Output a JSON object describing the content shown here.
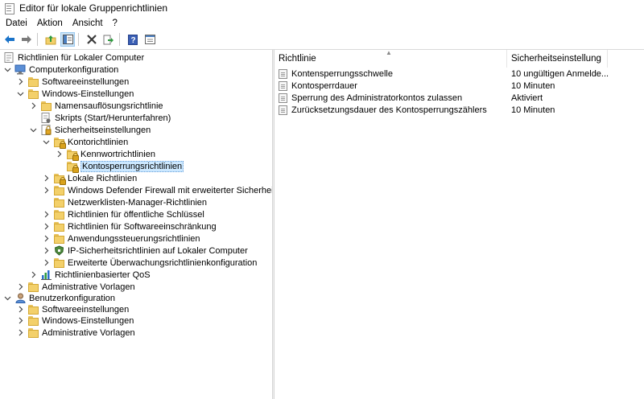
{
  "window": {
    "title": "Editor für lokale Gruppenrichtlinien"
  },
  "menu": {
    "items": [
      "Datei",
      "Aktion",
      "Ansicht",
      "?"
    ]
  },
  "colors": {
    "selection": "#cce8ff",
    "folder": "#f3d06a",
    "back_arrow": "#1a73c9",
    "forward_arrow": "#7a7a7a"
  },
  "toolbar": {
    "buttons": [
      "back-icon",
      "forward-icon",
      "up-folder-icon",
      "show-hide-tree-icon",
      "delete-icon",
      "export-list-icon",
      "help-icon",
      "properties-icon"
    ]
  },
  "tree": {
    "root": "Richtlinien für Lokaler Computer",
    "computer": "Computerkonfiguration",
    "c_software": "Softwareeinstellungen",
    "c_windows": "Windows-Einstellungen",
    "c_names": "Namensauflösungsrichtlinie",
    "c_scripts": "Skripts (Start/Herunterfahren)",
    "c_security": "Sicherheitseinstellungen",
    "c_account": "Kontorichtlinien",
    "c_password": "Kennwortrichtlinien",
    "c_lockout": "Kontosperrungsrichtlinien",
    "c_local": "Lokale Richtlinien",
    "c_firewall": "Windows Defender Firewall mit erweiterter Sicherheit",
    "c_netlist": "Netzwerklisten-Manager-Richtlinien",
    "c_pubkey": "Richtlinien für öffentliche Schlüssel",
    "c_srp": "Richtlinien für Softwareeinschränkung",
    "c_applocker": "Anwendungssteuerungsrichtlinien",
    "c_ipsec": "IP-Sicherheitsrichtlinien auf Lokaler Computer",
    "c_audit": "Erweiterte Überwachungsrichtlinienkonfiguration",
    "c_qos": "Richtlinienbasierter QoS",
    "c_admin": "Administrative Vorlagen",
    "user": "Benutzerkonfiguration",
    "u_software": "Softwareeinstellungen",
    "u_windows": "Windows-Einstellungen",
    "u_admin": "Administrative Vorlagen"
  },
  "list": {
    "col_policy": "Richtlinie",
    "col_setting": "Sicherheitseinstellung",
    "rows": [
      {
        "policy": "Kontensperrungsschwelle",
        "setting": "10 ungültigen Anmelde..."
      },
      {
        "policy": "Kontosperrdauer",
        "setting": "10 Minuten"
      },
      {
        "policy": "Sperrung des Administratorkontos zulassen",
        "setting": "Aktiviert"
      },
      {
        "policy": "Zurücksetzungsdauer des Kontosperrungszählers",
        "setting": "10 Minuten"
      }
    ]
  }
}
